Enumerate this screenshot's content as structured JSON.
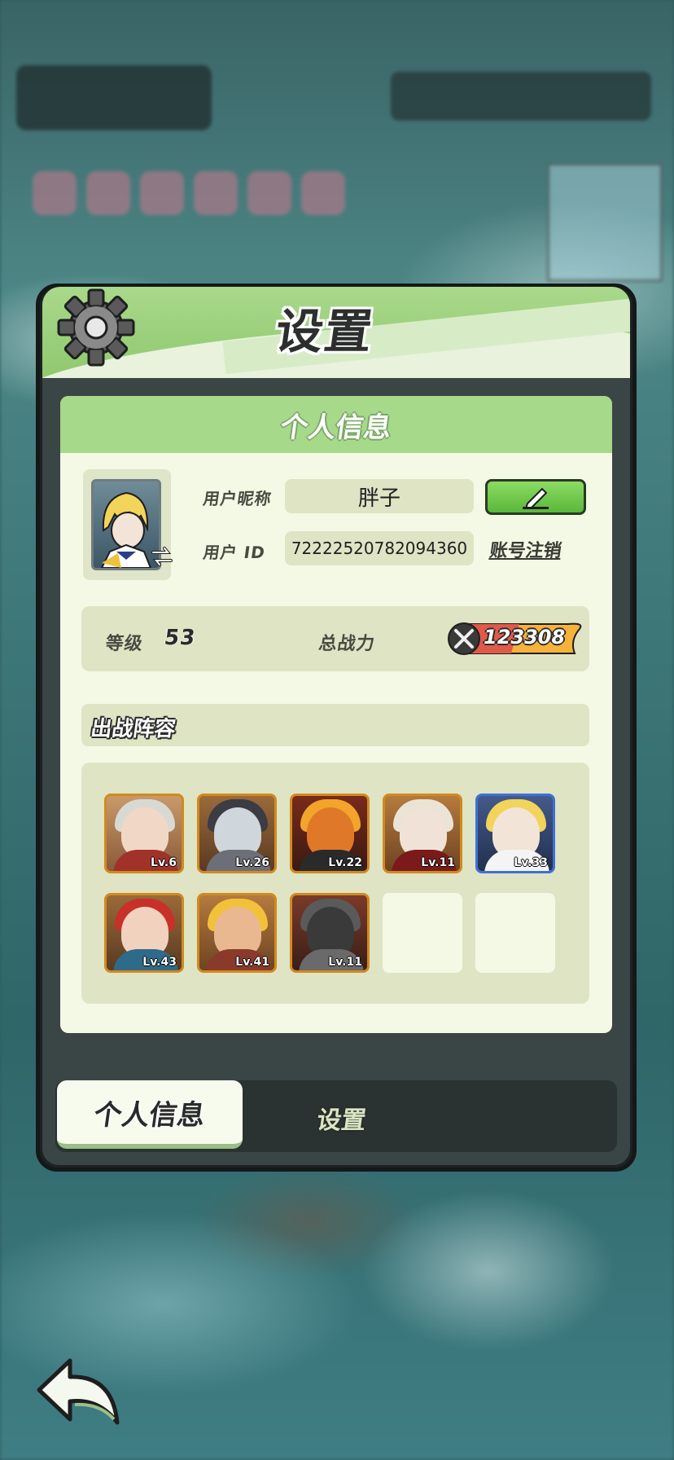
{
  "window": {
    "title": "设置"
  },
  "profile_card": {
    "heading": "个人信息",
    "nickname_label": "用户昵称",
    "nickname_value": "胖子",
    "id_label": "用户 ID",
    "id_value": "72222520782094360",
    "account_cancel_link": "账号注销"
  },
  "stats": {
    "level_label": "等级",
    "level_value": "53",
    "power_label": "总战力",
    "power_value": "123308"
  },
  "lineup": {
    "heading": "出战阵容",
    "heroes": [
      {
        "level": "Lv.6"
      },
      {
        "level": "Lv.26"
      },
      {
        "level": "Lv.22"
      },
      {
        "level": "Lv.11"
      },
      {
        "level": "Lv.33"
      },
      {
        "level": "Lv.43"
      },
      {
        "level": "Lv.41"
      },
      {
        "level": "Lv.11"
      }
    ],
    "empty_slots": 2
  },
  "tabs": [
    {
      "label": "个人信息",
      "active": true
    },
    {
      "label": "设置",
      "active": false
    }
  ],
  "icons": {
    "settings": "gear-icon",
    "edit": "pencil-icon",
    "swap": "swap-arrows-icon",
    "power": "crossed-swords-icon",
    "back": "back-arrow-icon"
  },
  "colors": {
    "header_green": "#a6d98a",
    "card_bg": "#f3f9e4",
    "edit_button": "#6cc84a",
    "power_badge": "#f7b23a"
  }
}
